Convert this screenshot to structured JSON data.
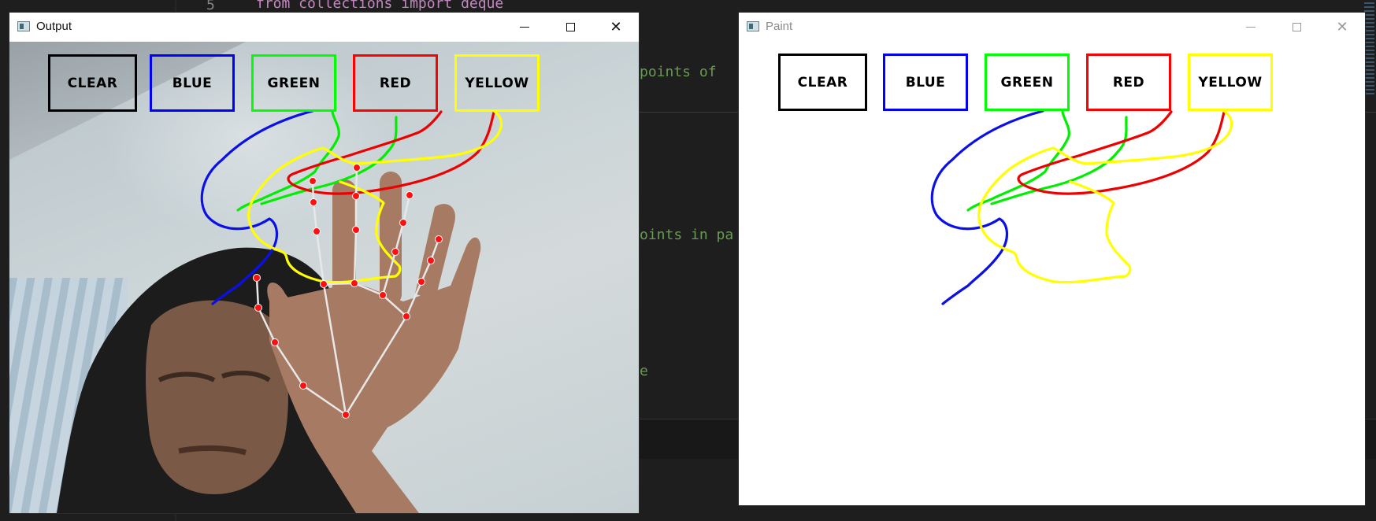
{
  "editor": {
    "line_number": "5",
    "code_top": "from collections import deque",
    "snippets": [
      "points of",
      "oints in pa",
      "e"
    ],
    "bottom_marker": "..."
  },
  "output_window": {
    "title": "Output",
    "icon": "opencv-window-icon"
  },
  "paint_window": {
    "title": "Paint",
    "icon": "opencv-window-icon"
  },
  "window_controls": {
    "minimize": "minimize-icon",
    "maximize": "maximize-icon",
    "close": "close-icon"
  },
  "buttons": [
    {
      "label": "CLEAR",
      "color": "#000000"
    },
    {
      "label": "BLUE",
      "color": "#0000ff"
    },
    {
      "label": "GREEN",
      "color": "#00ff00"
    },
    {
      "label": "RED",
      "color": "#ff0000"
    },
    {
      "label": "YELLOW",
      "color": "#ffff00"
    }
  ],
  "stroke_colors": {
    "blue": "#0a10e6",
    "green": "#00ee00",
    "red": "#ee0000",
    "yellow": "#ffff00"
  },
  "landmark_color": "#ff1010",
  "skeleton_color": "#e8e8e8"
}
